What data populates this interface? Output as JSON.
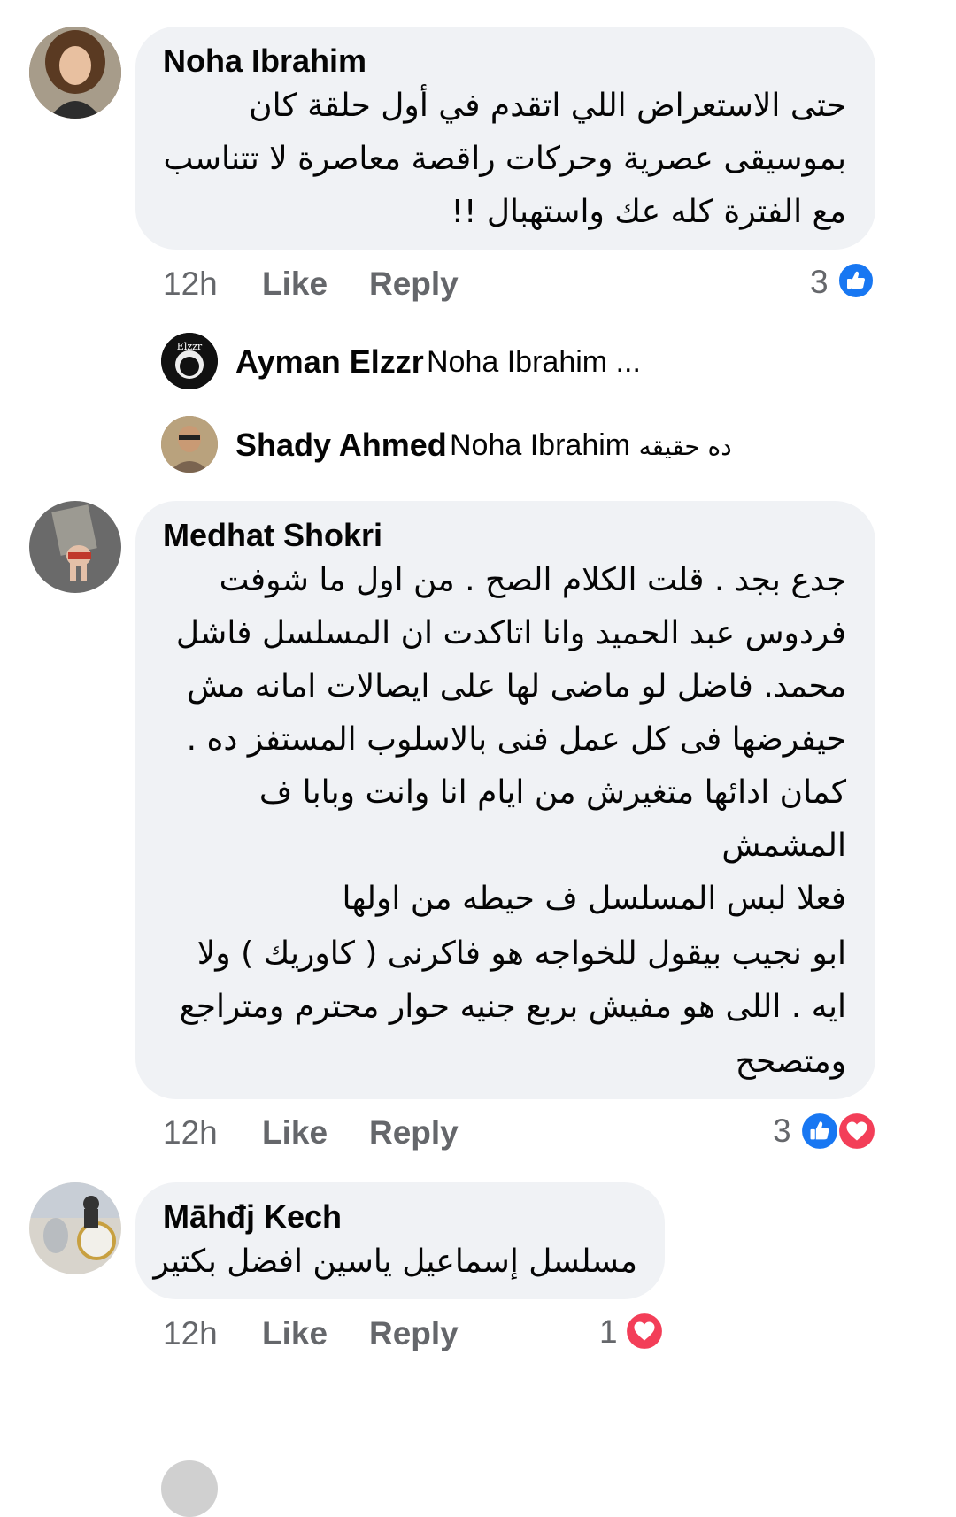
{
  "colors": {
    "bubble": "#f0f2f5",
    "meta_text": "#65676b",
    "like_blue": "#1877f2",
    "love_red": "#f33e58"
  },
  "comments": [
    {
      "author": "Noha Ibrahim",
      "lines": [
        "حتى الاستعراض اللي اتقدم في أول حلقة كان",
        "بموسيقى عصرية وحركات راقصة معاصرة لا تتناسب",
        "مع الفترة كله عك واستهبال !!"
      ],
      "time": "12h",
      "like_label": "Like",
      "reply_label": "Reply",
      "reaction_count": "3",
      "reactions": [
        "like-icon"
      ],
      "replies": [
        {
          "author": "Ayman Elzzr",
          "text": "Noha Ibrahim ...",
          "rtl_text": "",
          "avatar_text": "Elzzr"
        },
        {
          "author": "Shady Ahmed",
          "text": "Noha Ibrahim",
          "rtl_text": "ده حقيقه",
          "avatar_text": ""
        }
      ]
    },
    {
      "author": "Medhat Shokri",
      "lines": [
        "جدع بجد . قلت الكلام الصح . من اول ما شوفت",
        "فردوس عبد الحميد وانا اتاكدت ان المسلسل فاشل",
        "محمد. فاضل لو ماضى لها على ايصالات امانه مش",
        "حيفرضها فى كل عمل فنى بالاسلوب المستفز ده .",
        "كمان ادائها متغيرش من ايام انا وانت وبابا ف",
        "المشمش",
        "فعلا لبس المسلسل ف حيطه من اولها",
        "ابو نجيب بيقول للخواجه هو فاكرنى ( كاوريك ) ولا",
        "ايه . اللى هو مفيش بربع جنيه حوار محترم ومتراجع",
        "ومتصحح"
      ],
      "time": "12h",
      "like_label": "Like",
      "reply_label": "Reply",
      "reaction_count": "3",
      "reactions": [
        "like-icon",
        "love-icon"
      ]
    },
    {
      "author": "Māhđj Kech",
      "lines": [
        "مسلسل إسماعيل ياسين افضل بكتير"
      ],
      "time": "12h",
      "like_label": "Like",
      "reply_label": "Reply",
      "reaction_count": "1",
      "reactions": [
        "love-icon"
      ]
    }
  ]
}
